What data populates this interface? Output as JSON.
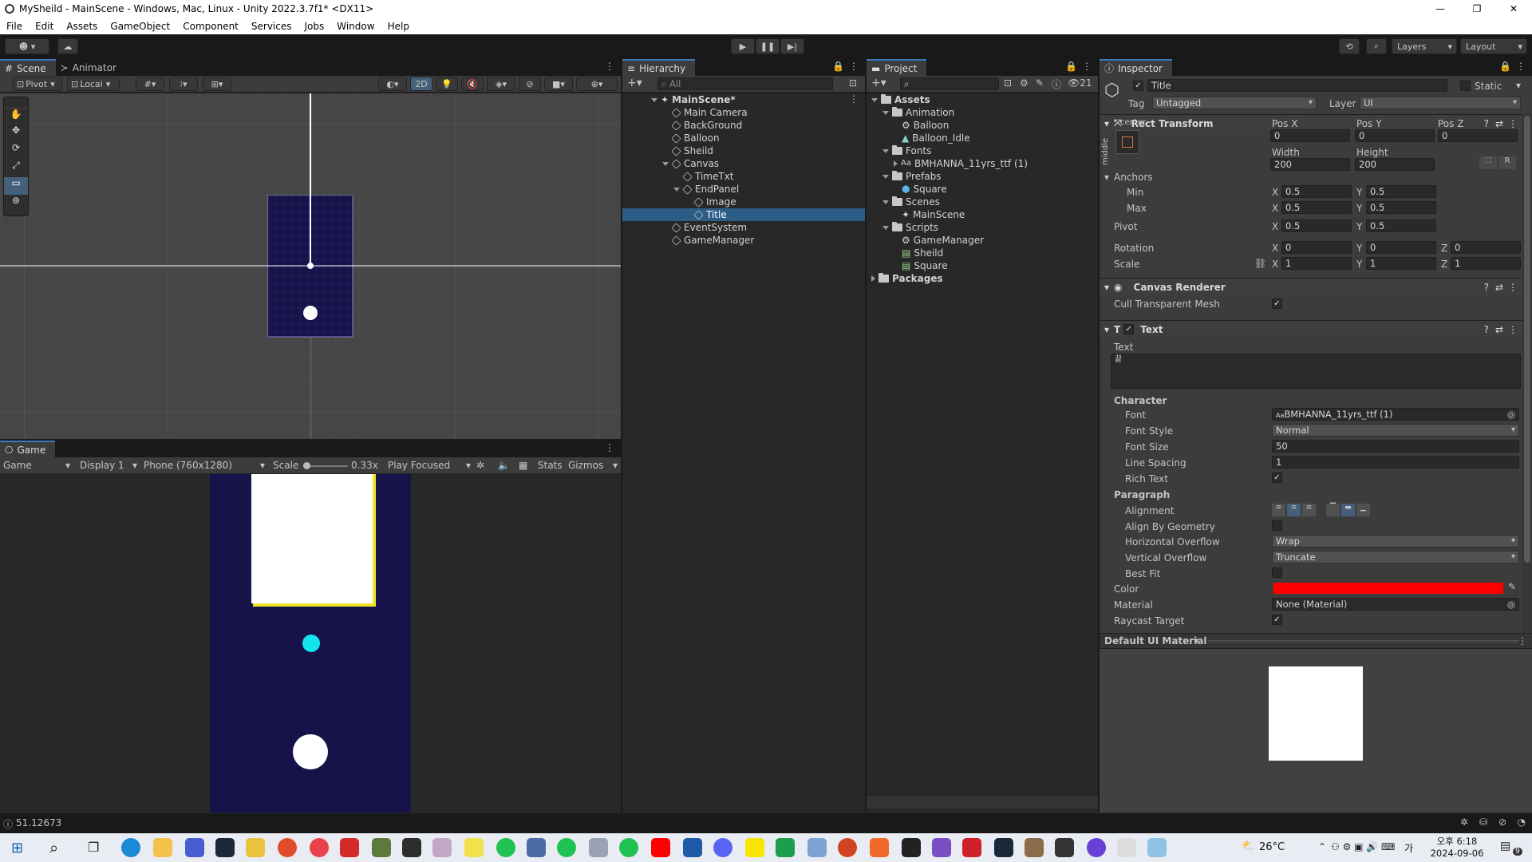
{
  "window": {
    "title": "MySheild - MainScene - Windows, Mac, Linux - Unity 2022.3.7f1* <DX11>"
  },
  "menu": [
    "File",
    "Edit",
    "Assets",
    "GameObject",
    "Component",
    "Services",
    "Jobs",
    "Window",
    "Help"
  ],
  "toolbar": {
    "layers": "Layers",
    "layout": "Layout"
  },
  "scene": {
    "tabs": [
      "Scene",
      "Animator"
    ],
    "pivot": "Pivot",
    "local": "Local",
    "mode2d": "2D"
  },
  "game": {
    "tab": "Game",
    "view": "Game",
    "display": "Display 1",
    "resolution": "Phone (760x1280)",
    "scale_label": "Scale",
    "scale_value": "0.33x",
    "play_mode": "Play Focused",
    "stats": "Stats",
    "gizmos": "Gizmos"
  },
  "hierarchy": {
    "tab": "Hierarchy",
    "search_placeholder": "All",
    "items": [
      "MainScene*",
      "Main Camera",
      "BackGround",
      "Balloon",
      "Sheild",
      "Canvas",
      "TimeTxt",
      "EndPanel",
      "Image",
      "Title",
      "EventSystem",
      "GameManager"
    ]
  },
  "project": {
    "tab": "Project",
    "badge": "21",
    "items": [
      "Assets",
      "Animation",
      "Balloon",
      "Balloon_Idle",
      "Fonts",
      "BMHANNA_11yrs_ttf (1)",
      "Prefabs",
      "Square",
      "Scenes",
      "MainScene",
      "Scripts",
      "GameManager",
      "Sheild",
      "Square",
      "Packages"
    ]
  },
  "inspector": {
    "tab": "Inspector",
    "object_name": "Title",
    "static": "Static",
    "tag_label": "Tag",
    "tag_value": "Untagged",
    "layer_label": "Layer",
    "layer_value": "UI",
    "rect": {
      "header": "Rect Transform",
      "anchor_preset_h": "center",
      "anchor_preset_v": "middle",
      "posx_label": "Pos X",
      "posy_label": "Pos Y",
      "posz_label": "Pos Z",
      "posx": "0",
      "posy": "0",
      "posz": "0",
      "width_label": "Width",
      "height_label": "Height",
      "width": "200",
      "height": "200",
      "anchors": "Anchors",
      "min": "Min",
      "max": "Max",
      "pivot": "Pivot",
      "min_x": "0.5",
      "min_y": "0.5",
      "max_x": "0.5",
      "max_y": "0.5",
      "pivot_x": "0.5",
      "pivot_y": "0.5",
      "rotation": "Rotation",
      "rot_x": "0",
      "rot_y": "0",
      "rot_z": "0",
      "scale": "Scale",
      "scale_x": "1",
      "scale_y": "1",
      "scale_z": "1",
      "x": "X",
      "y": "Y",
      "z": "Z",
      "r": "R"
    },
    "canvas_renderer": {
      "header": "Canvas Renderer",
      "cull": "Cull Transparent Mesh"
    },
    "text": {
      "header": "Text",
      "text_label": "Text",
      "text_value": "끝",
      "character": "Character",
      "font_label": "Font",
      "font_value": "BMHANNA_11yrs_ttf (1)",
      "font_style_label": "Font Style",
      "font_style_value": "Normal",
      "font_size_label": "Font Size",
      "font_size_value": "50",
      "line_spacing_label": "Line Spacing",
      "line_spacing_value": "1",
      "rich_text_label": "Rich Text",
      "paragraph": "Paragraph",
      "alignment_label": "Alignment",
      "align_geo_label": "Align By Geometry",
      "hover_label": "Horizontal Overflow",
      "hover_value": "Wrap",
      "vover_label": "Vertical Overflow",
      "vover_value": "Truncate",
      "bestfit_label": "Best Fit",
      "color_label": "Color",
      "color_value": "#ff0000",
      "material_label": "Material",
      "material_value": "None (Material)",
      "raycast_label": "Raycast Target"
    },
    "material_preview": "Default UI Material"
  },
  "status": {
    "message": "51.12673"
  },
  "taskbar": {
    "weather": "26°C",
    "ime": "가",
    "time": "오후 6:18",
    "date": "2024-09-06",
    "notif": "9"
  },
  "colors": {
    "accent": "#3a79bb",
    "game_bg": "#15134a",
    "text_red": "#ff0000"
  }
}
